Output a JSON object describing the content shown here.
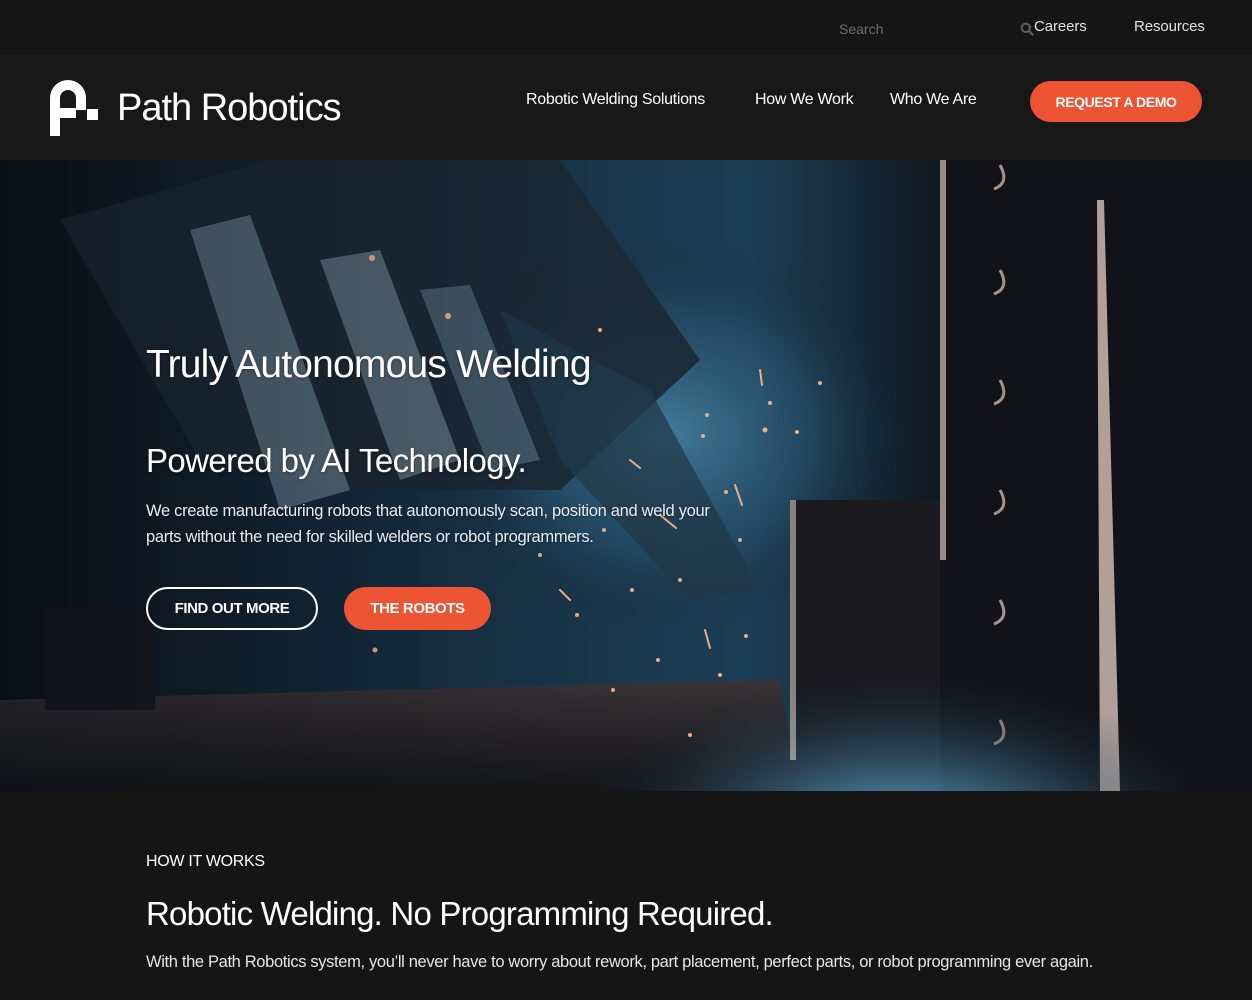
{
  "topbar": {
    "search": {
      "placeholder": "Search",
      "value": "",
      "icon": "search-icon"
    },
    "links": [
      {
        "label": "Careers"
      },
      {
        "label": "Resources"
      }
    ]
  },
  "header": {
    "brand": {
      "name": "Path Robotics",
      "icon": "path-robotics-logo-icon"
    },
    "nav": [
      {
        "label": "Robotic Welding Solutions"
      },
      {
        "label": "How We Work"
      },
      {
        "label": "Who We Are"
      }
    ],
    "cta_label": "REQUEST A DEMO"
  },
  "hero": {
    "title": "Truly Autonomous Welding",
    "subtitle": "Powered by AI Technology.",
    "description": "We create manufacturing robots that autonomously scan, position and weld your parts without the need for skilled welders or robot programmers.",
    "buttons": {
      "secondary": "FIND OUT MORE",
      "primary": "THE ROBOTS"
    },
    "background": "robotic-welding-arm-with-sparks"
  },
  "how_it_works": {
    "eyebrow": "HOW IT WORKS",
    "title": "Robotic Welding. No Programming Required.",
    "description": "With the Path Robotics system, you’ll never have to worry about rework, part placement, perfect parts, or robot programming ever again."
  },
  "colors": {
    "accent": "#ec5434",
    "background": "#151515",
    "nav_background": "#181818",
    "text": "#ffffff"
  }
}
